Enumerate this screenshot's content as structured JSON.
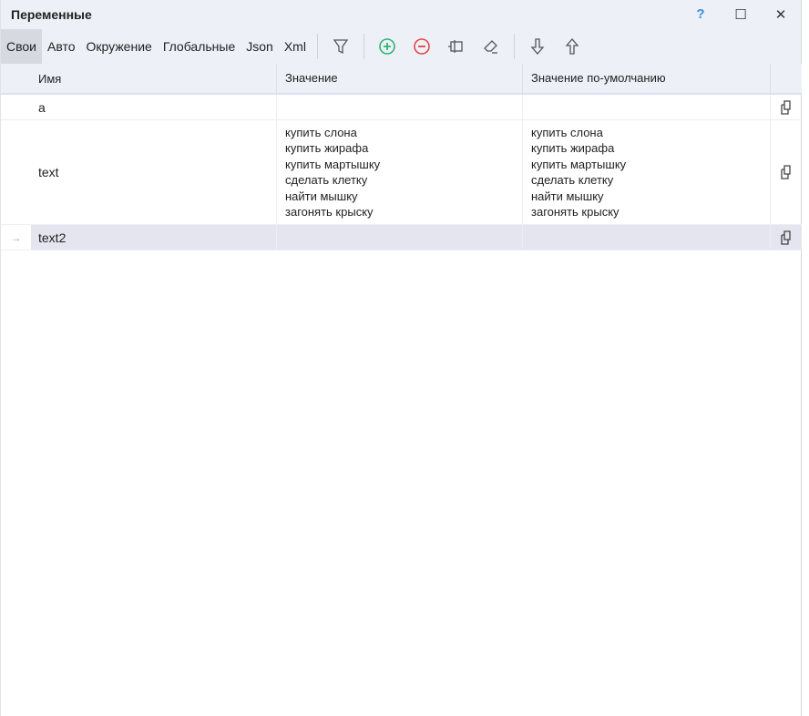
{
  "window": {
    "title": "Переменные",
    "help": "?",
    "maximize": "☐",
    "close": "✕"
  },
  "tabs": [
    {
      "label": "Свои",
      "active": true
    },
    {
      "label": "Авто"
    },
    {
      "label": "Окружение"
    },
    {
      "label": "Глобальные"
    },
    {
      "label": "Json"
    },
    {
      "label": "Xml"
    }
  ],
  "toolbar_icons": [
    "filter-icon",
    "add-icon",
    "remove-icon",
    "frame-icon",
    "eraser-icon",
    "arrow-down-icon",
    "arrow-up-icon"
  ],
  "columns": {
    "name": "Имя",
    "value": "Значение",
    "default": "Значение по-умолчанию"
  },
  "rows": [
    {
      "name": "a",
      "value": [],
      "default": []
    },
    {
      "name": "text",
      "value": [
        "купить слона",
        "купить жирафа",
        "купить мартышку",
        "сделать клетку",
        "найти мышку",
        "загонять крыску"
      ],
      "default": [
        "купить слона",
        "купить жирафа",
        "купить мартышку",
        "сделать клетку",
        "найти мышку",
        "загонять крыску"
      ]
    },
    {
      "name": "text2",
      "value": [],
      "default": [],
      "selected": true,
      "marker": "→"
    }
  ],
  "colors": {
    "add": "#2bb673",
    "remove": "#e04848",
    "help": "#3a8de0"
  }
}
